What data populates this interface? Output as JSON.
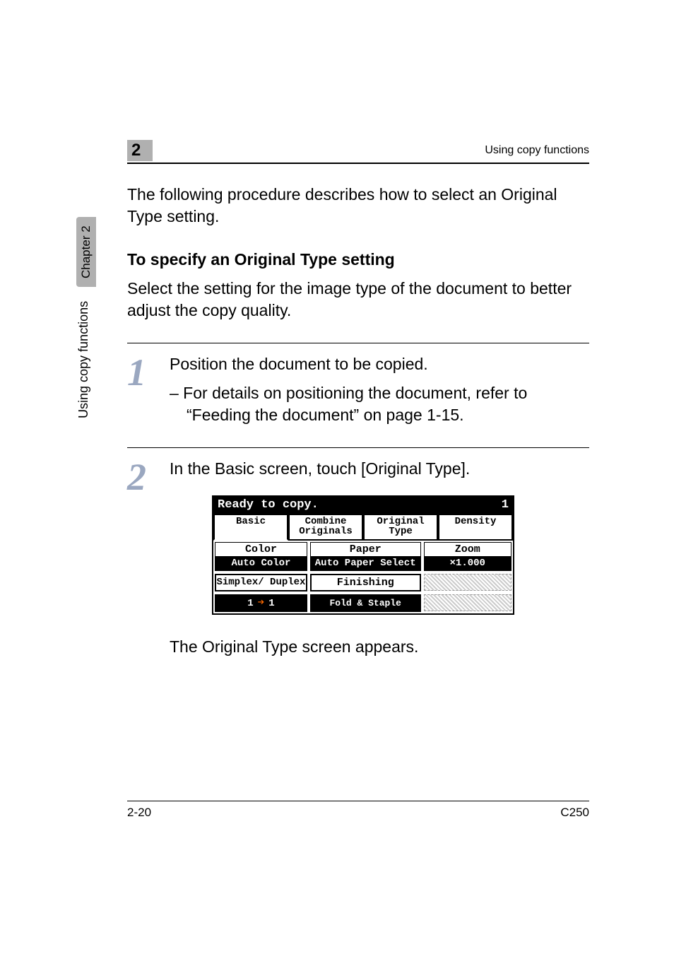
{
  "header": {
    "chapter_number": "2",
    "running_title": "Using copy functions"
  },
  "side": {
    "chapter_tab": "Chapter 2",
    "section_tab": "Using copy functions"
  },
  "intro": "The following procedure describes how to select an Original Type setting.",
  "heading": "To specify an Original Type setting",
  "lead": "Select the setting for the image type of the document to better adjust the copy quality.",
  "steps": [
    {
      "num": "1",
      "text": "Position the document to be copied.",
      "sub": "– For details on positioning the document, refer to “Feeding the document” on page 1-15."
    },
    {
      "num": "2",
      "text": "In the Basic screen, touch [Original Type].",
      "after": "The Original Type screen appears."
    }
  ],
  "lcd": {
    "status": "Ready to copy.",
    "count": "1",
    "tabs": [
      "Basic",
      "Combine Originals",
      "Original Type",
      "Density"
    ],
    "selected_tab_index": 0,
    "col1": {
      "label": "Color",
      "value": "Auto Color"
    },
    "col2": {
      "label": "Paper",
      "value": "Auto Paper Select"
    },
    "col3": {
      "label": "Zoom",
      "value": "×1.000"
    },
    "row2_left_label": "Simplex/ Duplex",
    "row2_mid_button": "Finishing",
    "row3_left_value": "1 ➔ 1",
    "row3_mid_value": "Fold & Staple"
  },
  "footer": {
    "page": "2-20",
    "model": "C250"
  }
}
